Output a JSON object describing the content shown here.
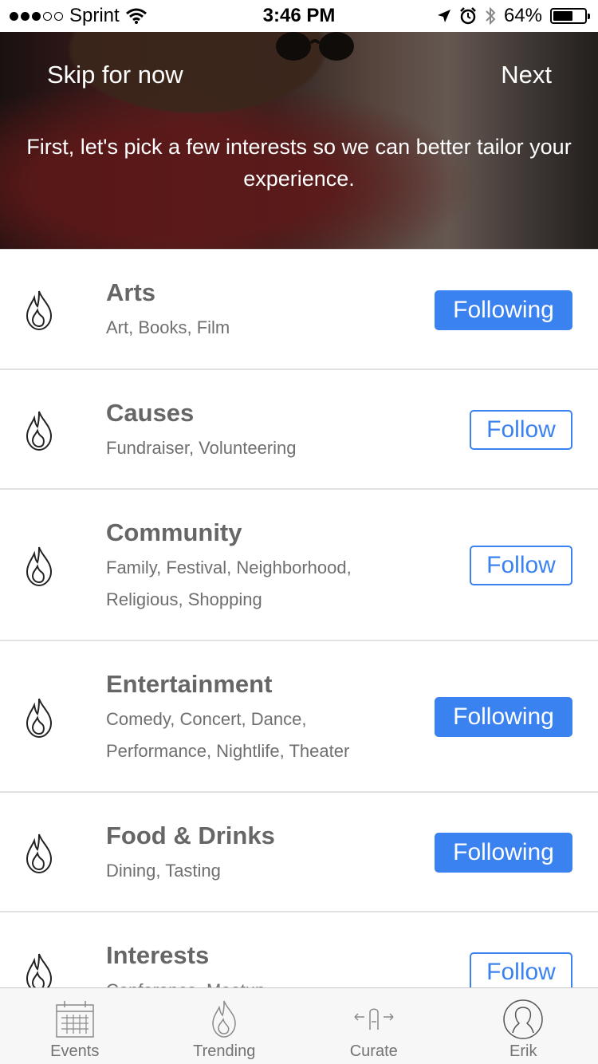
{
  "status_bar": {
    "carrier": "Sprint",
    "time": "3:46 PM",
    "battery": "64%",
    "battery_level": 0.64,
    "signal_bars_filled": 3,
    "signal_bars_total": 5
  },
  "hero": {
    "skip_label": "Skip for now",
    "next_label": "Next",
    "message": "First, let's pick a few interests so we can better tailor your experience."
  },
  "interests": [
    {
      "title": "Arts",
      "subtitle": "Art, Books, Film",
      "button": "Following",
      "state": "following"
    },
    {
      "title": "Causes",
      "subtitle": "Fundraiser, Volunteering",
      "button": "Follow",
      "state": "follow"
    },
    {
      "title": "Community",
      "subtitle": "Family, Festival, Neighborhood, Religious, Shopping",
      "button": "Follow",
      "state": "follow"
    },
    {
      "title": "Entertainment",
      "subtitle": "Comedy, Concert, Dance, Performance, Nightlife, Theater",
      "button": "Following",
      "state": "following"
    },
    {
      "title": "Food & Drinks",
      "subtitle": "Dining, Tasting",
      "button": "Following",
      "state": "following"
    },
    {
      "title": "Interests",
      "subtitle": "Conference, Meetup",
      "button": "Follow",
      "state": "follow"
    }
  ],
  "tabs": [
    {
      "label": "Events",
      "icon": "calendar-icon"
    },
    {
      "label": "Trending",
      "icon": "flame-icon"
    },
    {
      "label": "Curate",
      "icon": "swipe-icon"
    },
    {
      "label": "Erik",
      "icon": "profile-icon"
    }
  ],
  "colors": {
    "accent": "#3a82ef",
    "title_text": "#666666",
    "tab_text": "#737373"
  }
}
